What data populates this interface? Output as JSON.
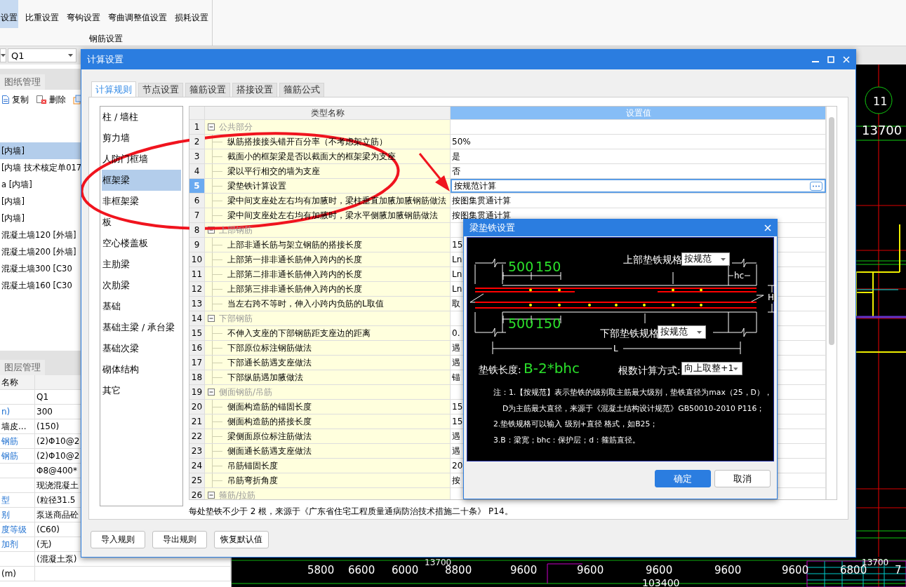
{
  "ribbon": {
    "buttons": [
      {
        "label": "设置",
        "selected": true
      },
      {
        "label": "比重设置",
        "selected": false
      },
      {
        "label": "弯钩设置",
        "selected": false
      },
      {
        "label": "弯曲调整值设置",
        "selected": false
      },
      {
        "label": "损耗设置",
        "selected": false
      }
    ],
    "group_label": "钢筋设置"
  },
  "toolbar": {
    "component_combo": "Q1"
  },
  "drawing_panel": {
    "tab": "图纸管理",
    "actions": [
      {
        "kind": "copy",
        "label": "复制"
      },
      {
        "kind": "delete",
        "label": "删除"
      },
      {
        "kind": "stack"
      }
    ],
    "items": [
      {
        "label": "[内墙]",
        "selected": true
      },
      {
        "label": "[内墙 技术核定单017",
        "selected": false
      },
      {
        "label": "a [内墙]",
        "selected": false
      },
      {
        "label": "[内墙]",
        "selected": false
      },
      {
        "label": "[内墙]",
        "selected": false
      },
      {
        "label": "混凝土墙120 [外墙]",
        "selected": false
      },
      {
        "label": "混凝土墙200 [外墙]",
        "selected": false
      },
      {
        "label": "混凝土墙300 [C30",
        "selected": false
      },
      {
        "label": "混凝土墙160 [C30",
        "selected": false
      }
    ]
  },
  "layer_panel": {
    "tab": "图层管理",
    "header": "名称",
    "rows": [
      {
        "value": "Q1",
        "link": false
      },
      {
        "name": "n)",
        "value": "300",
        "link": true
      },
      {
        "name": "墙皮...",
        "value": "(150)",
        "link": false
      },
      {
        "name": "钢筋",
        "value": "(2)Φ10@2",
        "link": true
      },
      {
        "name": "钢筋",
        "value": "(2)Φ10@2",
        "link": true
      },
      {
        "value": "Φ8@400*",
        "link": false
      },
      {
        "value": "现浇混凝土",
        "link": false
      },
      {
        "name": "型",
        "value": "(粒径31.5",
        "link": true
      },
      {
        "name": "别",
        "value": "泵送商品砼",
        "link": true
      },
      {
        "name": "度等级",
        "value": "(C60)",
        "link": true
      },
      {
        "name": "加剂",
        "value": "(无)",
        "link": true
      },
      {
        "value": "(混凝土泵)",
        "link": false
      },
      {
        "name": "(m)",
        "link": false
      }
    ]
  },
  "cad": {
    "axis_label": "11",
    "top_dim": "13700",
    "upper_dims": [
      "13700",
      "13700"
    ],
    "bottom_dims": [
      "5800",
      "6600",
      "6000",
      "8800",
      "9600",
      "9600",
      "9600",
      "9600",
      "9600",
      "6800",
      "7"
    ],
    "total_dim": "103400"
  },
  "calc_dialog": {
    "title": "计算设置",
    "tabs": [
      {
        "label": "计算规则",
        "selected": true
      },
      {
        "label": "节点设置",
        "selected": false
      },
      {
        "label": "箍筋设置",
        "selected": false
      },
      {
        "label": "搭接设置",
        "selected": false
      },
      {
        "label": "箍筋公式",
        "selected": false
      }
    ],
    "categories": [
      {
        "label": "柱 / 墙柱",
        "selected": false
      },
      {
        "label": "剪力墙",
        "selected": false
      },
      {
        "label": "人防门框墙",
        "selected": false
      },
      {
        "label": "框架梁",
        "selected": true
      },
      {
        "label": "非框架梁",
        "selected": false
      },
      {
        "label": "板",
        "selected": false
      },
      {
        "label": "空心楼盖板",
        "selected": false
      },
      {
        "label": "主肋梁",
        "selected": false
      },
      {
        "label": "次肋梁",
        "selected": false
      },
      {
        "label": "基础",
        "selected": false
      },
      {
        "label": "基础主梁 / 承台梁",
        "selected": false
      },
      {
        "label": "基础次梁",
        "selected": false
      },
      {
        "label": "砌体结构",
        "selected": false
      },
      {
        "label": "其它",
        "selected": false
      }
    ],
    "table": {
      "columns": [
        "类型名称",
        "设置值"
      ],
      "rows": [
        {
          "no": "1",
          "kind": "group",
          "name": "公共部分",
          "expanded": true,
          "selected": false
        },
        {
          "no": "2",
          "kind": "item",
          "name": "纵筋搭接接头错开百分率（不考虑架立筋）",
          "value": "50%",
          "selected": false
        },
        {
          "no": "3",
          "kind": "item",
          "name": "截面小的框架梁是否以截面大的框架梁为支座",
          "value": "是",
          "selected": false
        },
        {
          "no": "4",
          "kind": "item",
          "name": "梁以平行相交的墙为支座",
          "value": "否",
          "selected": false
        },
        {
          "no": "5",
          "kind": "item",
          "name": "梁垫铁计算设置",
          "value": "按规范计算",
          "selected": true
        },
        {
          "no": "6",
          "kind": "item",
          "name": "梁中间支座处左右均有加腋时，梁柱垂直加腋加腋钢筋做法",
          "value": "按图集贯通计算",
          "selected": false
        },
        {
          "no": "7",
          "kind": "item",
          "name": "梁中间支座处左右均有加腋时，梁水平侧腋加腋钢筋做法",
          "value": "按图集贯通计算",
          "selected": false
        },
        {
          "no": "8",
          "kind": "group",
          "name": "上部钢筋",
          "expanded": true,
          "selected": false
        },
        {
          "no": "9",
          "kind": "item",
          "name": "上部非通长筋与架立钢筋的搭接长度",
          "value": "15",
          "selected": false
        },
        {
          "no": "10",
          "kind": "item",
          "name": "上部第一排非通长筋伸入跨内的长度",
          "value": "Ln",
          "selected": false
        },
        {
          "no": "11",
          "kind": "item",
          "name": "上部第二排非通长筋伸入跨内的长度",
          "value": "Ln",
          "selected": false
        },
        {
          "no": "12",
          "kind": "item",
          "name": "上部第三排非通长筋伸入跨内的长度",
          "value": "Ln",
          "selected": false
        },
        {
          "no": "13",
          "kind": "item",
          "name": "当左右跨不等时，伸入小跨内负筋的L取值",
          "value": "取",
          "selected": false
        },
        {
          "no": "14",
          "kind": "group",
          "name": "下部钢筋",
          "expanded": true,
          "selected": false
        },
        {
          "no": "15",
          "kind": "item",
          "name": "不伸入支座的下部钢筋距支座边的距离",
          "value": "0.",
          "selected": false
        },
        {
          "no": "16",
          "kind": "item",
          "name": "下部原位标注钢筋做法",
          "value": "遇",
          "selected": false
        },
        {
          "no": "17",
          "kind": "item",
          "name": "下部通长筋遇支座做法",
          "value": "遇",
          "selected": false
        },
        {
          "no": "18",
          "kind": "item",
          "name": "下部纵筋遇加腋做法",
          "value": "锚",
          "selected": false
        },
        {
          "no": "19",
          "kind": "group",
          "name": "侧面钢筋/吊筋",
          "expanded": true,
          "selected": false
        },
        {
          "no": "20",
          "kind": "item",
          "name": "侧面构造筋的锚固长度",
          "value": "15",
          "selected": false
        },
        {
          "no": "21",
          "kind": "item",
          "name": "侧面构造筋的搭接长度",
          "value": "15",
          "selected": false
        },
        {
          "no": "22",
          "kind": "item",
          "name": "梁侧面原位标注筋做法",
          "value": "遇",
          "selected": false
        },
        {
          "no": "23",
          "kind": "item",
          "name": "侧面通长筋遇支座做法",
          "value": "遇",
          "selected": false
        },
        {
          "no": "24",
          "kind": "item",
          "name": "吊筋锚固长度",
          "value": "20",
          "selected": false
        },
        {
          "no": "25",
          "kind": "item",
          "name": "吊筋弯折角度",
          "value": "按",
          "selected": false
        },
        {
          "no": "26",
          "kind": "group",
          "name": "箍筋/拉筋",
          "expanded": true,
          "selected": false
        }
      ]
    },
    "note": "每处垫铁不少于 2 根，来源于《广东省住宅工程质量通病防治技术措施二十条》 P14。",
    "buttons": [
      "导入规则",
      "导出规则",
      "恢复默认值"
    ]
  },
  "pad_dialog": {
    "title": "梁垫铁设置",
    "top_spec_label": "上部垫铁规格",
    "top_spec": "按规范",
    "bottom_spec_label": "下部垫铁规格",
    "bottom_spec": "按规范",
    "top_dims": [
      "500",
      "150"
    ],
    "bottom_dims": [
      "500",
      "150"
    ],
    "hc": "hc",
    "h": "H",
    "l": "L",
    "length_label": "垫铁长度:",
    "length_formula": "B-2*bhc",
    "count_label": "根数计算方式:",
    "count_method": "向上取整+1",
    "notes": [
      "注：1.【按规范】表示垫铁的级别取主筋最大级别，垫铁直径为max（25，D），",
      "D为主筋最大直径，来源于《混凝土结构设计规范》GB50010-2010 P116；",
      "2.垫铁规格可以输入 级别+直径 格式，如B25；",
      "3.B：梁宽；bhc：保护层；d：箍筋直径。"
    ],
    "buttons": [
      {
        "kind": "primary",
        "label": "确定"
      },
      {
        "kind": "secondary",
        "label": "取消"
      }
    ]
  }
}
